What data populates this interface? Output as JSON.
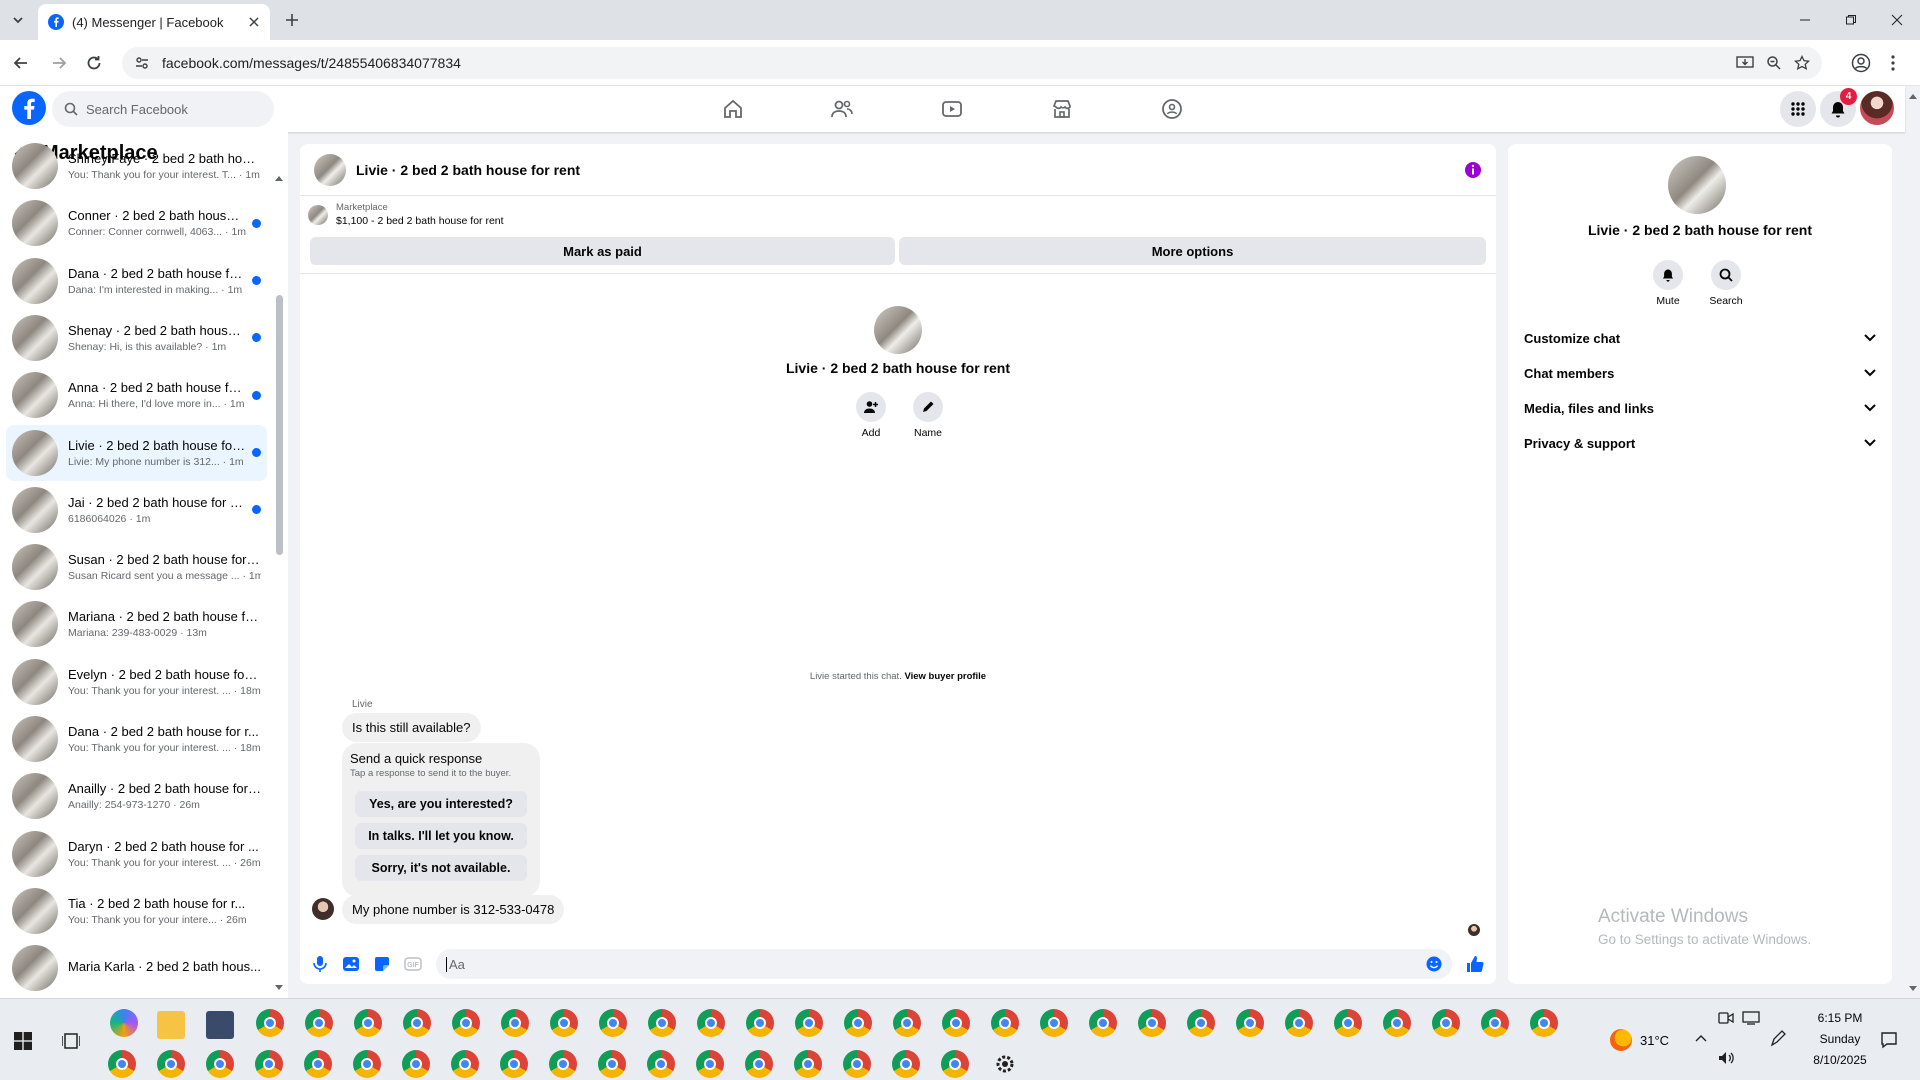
{
  "browser": {
    "tab_title": "(4) Messenger | Facebook",
    "url": "facebook.com/messages/t/24855406834077834"
  },
  "fb": {
    "search_placeholder": "Search Facebook",
    "notification_count": "4",
    "brand_color": "#0866ff"
  },
  "sidebar": {
    "title": "Marketplace",
    "conversations": [
      {
        "name": "Shirley Faye · 2 bed 2 bath hous...",
        "preview": "You: Thank you for your interest. T... · 1m",
        "unread": false
      },
      {
        "name": "Conner · 2 bed 2 bath house f...",
        "preview": "Conner: Conner cornwell, 4063... · 1m",
        "unread": true
      },
      {
        "name": "Dana · 2 bed 2 bath house for...",
        "preview": "Dana: I'm interested in making... · 1m",
        "unread": true
      },
      {
        "name": "Shenay · 2 bed 2 bath house f...",
        "preview": "Shenay: Hi, is this available? · 1m",
        "unread": true
      },
      {
        "name": "Anna · 2 bed 2 bath house for...",
        "preview": "Anna: Hi there, I'd love more in... · 1m",
        "unread": true
      },
      {
        "name": "Livie · 2 bed 2 bath house for ...",
        "preview": "Livie: My phone number is 312... · 1m",
        "unread": true
      },
      {
        "name": "Jai · 2 bed 2 bath house for rent",
        "preview": "6186064026 · 1m",
        "unread": true
      },
      {
        "name": "Susan · 2 bed 2 bath house for r...",
        "preview": "Susan Ricard sent you a message ... · 1m",
        "unread": false
      },
      {
        "name": "Mariana · 2 bed 2 bath house fo...",
        "preview": "Mariana: 239-483-0029 · 13m",
        "unread": false
      },
      {
        "name": "Evelyn · 2 bed 2 bath house for ...",
        "preview": "You: Thank you for your interest. ... · 18m",
        "unread": false
      },
      {
        "name": "Dana · 2 bed 2 bath house for r...",
        "preview": "You: Thank you for your interest. ... · 18m",
        "unread": false
      },
      {
        "name": "Anailly · 2 bed 2 bath house for ...",
        "preview": "Anailly: 254-973-1270 · 26m",
        "unread": false
      },
      {
        "name": "Daryn · 2 bed 2 bath house for ...",
        "preview": "You: Thank you for your interest. ... · 26m",
        "unread": false
      },
      {
        "name": "Tia · 2 bed 2 bath house for r...",
        "preview": "You: Thank you for your intere... · 26m",
        "unread": false
      },
      {
        "name": "Maria Karla · 2 bed 2 bath hous...",
        "preview": "",
        "unread": false
      }
    ]
  },
  "chat": {
    "title": "Livie · 2 bed 2 bath house for rent",
    "listing_source": "Marketplace",
    "listing_desc": "$1,100 - 2 bed 2 bath house for rent",
    "mark_paid": "Mark as paid",
    "more_options": "More options",
    "center_name": "Livie · 2 bed 2 bath house for rent",
    "add_label": "Add",
    "name_label": "Name",
    "started_text": "Livie started this chat.",
    "view_profile": "View buyer profile",
    "sender": "Livie",
    "msg1": "Is this still available?",
    "quick_title": "Send a quick response",
    "quick_sub": "Tap a response to send it to the buyer.",
    "quick_options": [
      "Yes, are you interested?",
      "In talks. I'll let you know.",
      "Sorry, it's not available."
    ],
    "msg2": "My phone number is 312-533-0478",
    "composer_placeholder": "Aa"
  },
  "info": {
    "title": "Livie · 2 bed 2 bath house for rent",
    "mute": "Mute",
    "search": "Search",
    "rows": [
      "Customize chat",
      "Chat members",
      "Media, files and links",
      "Privacy & support"
    ],
    "watermark_title": "Activate Windows",
    "watermark_sub": "Go to Settings to activate Windows."
  },
  "taskbar": {
    "temp": "31°C",
    "time": "6:15 PM",
    "day": "Sunday",
    "date": "8/10/2025"
  }
}
